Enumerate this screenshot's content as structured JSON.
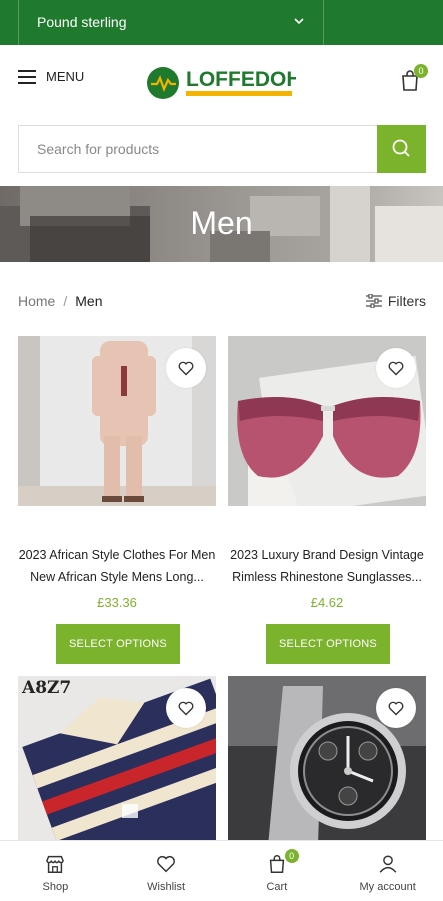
{
  "topbar": {
    "currency": "Pound sterling"
  },
  "header": {
    "menu_label": "MENU",
    "logo_text": "LOFFEDOH",
    "cart_count": "0"
  },
  "search": {
    "placeholder": "Search for products"
  },
  "hero": {
    "title": "Men"
  },
  "breadcrumb": {
    "home": "Home",
    "separator": "/",
    "current": "Men"
  },
  "filters_label": "Filters",
  "products": [
    {
      "title_line1": "2023 African Style Clothes For Men",
      "title_line2": "New African Style Mens Long...",
      "price": "£33.36",
      "button": "SELECT OPTIONS"
    },
    {
      "title_line1": "2023 Luxury Brand Design Vintage",
      "title_line2": "Rimless Rhinestone Sunglasses...",
      "price": "£4.62",
      "button": "SELECT OPTIONS"
    },
    {
      "brand_mark": "A8Z7"
    },
    {}
  ],
  "bottom_nav": [
    {
      "label": "Shop",
      "icon": "shop-icon"
    },
    {
      "label": "Wishlist",
      "icon": "heart-icon"
    },
    {
      "label": "Cart",
      "icon": "cart-icon",
      "badge": "0"
    },
    {
      "label": "My account",
      "icon": "user-icon"
    }
  ],
  "colors": {
    "brand_green": "#1f7a2e",
    "accent_green": "#7cb32d"
  }
}
